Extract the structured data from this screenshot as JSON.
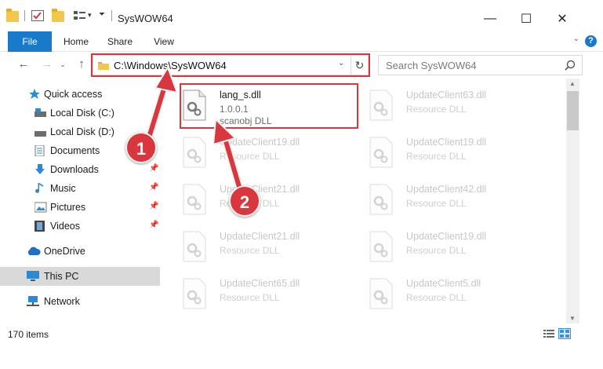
{
  "window": {
    "title": "SysWOW64",
    "minimize": "—",
    "maximize": "☐",
    "close": "✕"
  },
  "ribbon": {
    "tabs": [
      "File",
      "Home",
      "Share",
      "View"
    ],
    "help": "?"
  },
  "address": {
    "path": "C:\\Windows\\SysWOW64",
    "search_placeholder": "Search SysWOW64"
  },
  "nav": {
    "quick_access": "Quick access",
    "items": [
      {
        "label": "Local Disk (C:)",
        "pinned": false
      },
      {
        "label": "Local Disk (D:)",
        "pinned": false
      },
      {
        "label": "Documents",
        "pinned": false
      },
      {
        "label": "Downloads",
        "pinned": true
      },
      {
        "label": "Music",
        "pinned": true
      },
      {
        "label": "Pictures",
        "pinned": true
      },
      {
        "label": "Videos",
        "pinned": true
      }
    ],
    "onedrive": "OneDrive",
    "this_pc": "This PC",
    "network": "Network"
  },
  "files": {
    "highlighted": {
      "name": "lang_s.dll",
      "version": "1.0.0.1",
      "description": "scanobj DLL"
    },
    "right_column": [
      {
        "name": "UpdateClient63.dll",
        "description": "Resource DLL"
      },
      {
        "name": "UpdateClient19.dll",
        "description": "Resource DLL"
      },
      {
        "name": "UpdateClient42.dll",
        "description": "Resource DLL"
      },
      {
        "name": "UpdateClient19.dll",
        "description": "Resource DLL"
      },
      {
        "name": "UpdateClient5.dll",
        "description": "Resource DLL"
      }
    ],
    "left_column": [
      {
        "name": "UpdateClient19.dll",
        "description": "Resource DLL"
      },
      {
        "name": "UpdateClient21.dll",
        "description": "Resource DLL"
      },
      {
        "name": "UpdateClient21.dll",
        "description": "Resource DLL"
      },
      {
        "name": "UpdateClient65.dll",
        "description": "Resource DLL"
      }
    ]
  },
  "status": {
    "item_count": "170 items"
  },
  "annotations": {
    "marker_1": "1",
    "marker_2": "2",
    "color": "#d9363e"
  }
}
